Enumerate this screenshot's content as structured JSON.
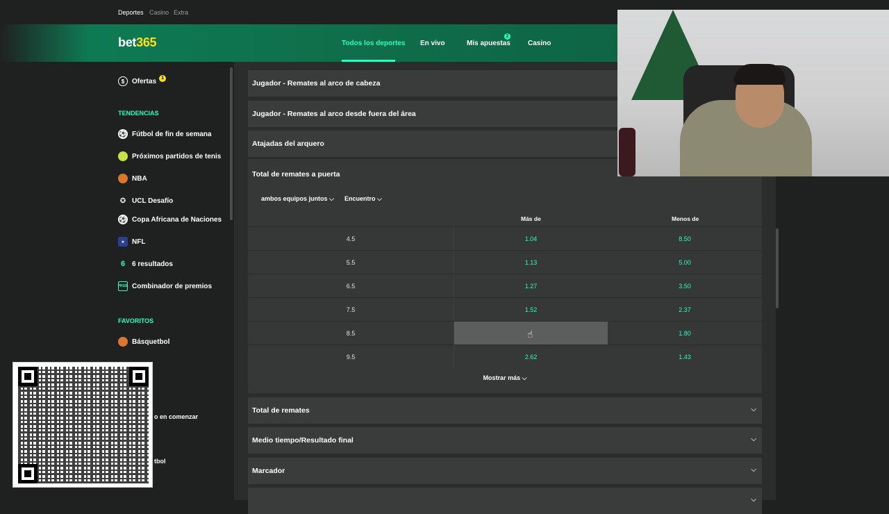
{
  "top_tabs": [
    "Deportes",
    "Casino",
    "Extra"
  ],
  "logo": {
    "main": "bet",
    "accent": "365"
  },
  "nav": {
    "items": [
      "Todos los deportes",
      "En vivo",
      "Mis apuestas",
      "Casino"
    ],
    "active": "Todos los deportes",
    "bets_badge": "2"
  },
  "sidebar": {
    "offers": {
      "label": "Ofertas",
      "badge": "1"
    },
    "trends_heading": "TENDENCIAS",
    "trends": [
      {
        "label": "Fútbol de fin de semana",
        "icon": "soccer-ball-icon"
      },
      {
        "label": "Próximos partidos de tenis",
        "icon": "tennis-ball-icon"
      },
      {
        "label": "NBA",
        "icon": "basketball-icon"
      },
      {
        "label": "UCL Desafío",
        "icon": "ucl-icon"
      },
      {
        "label": "Copa Africana de Naciones",
        "icon": "soccer-ball-icon"
      },
      {
        "label": "NFL",
        "icon": "nfl-icon"
      },
      {
        "label": "6 resultados",
        "icon": "six-results-icon"
      },
      {
        "label": "Combinador de premios",
        "icon": "prize-icon"
      }
    ],
    "favorites_heading": "FAVORITOS",
    "favorites": [
      {
        "label": "Básquetbol",
        "icon": "basketball-icon"
      }
    ],
    "partial_1": "o en comenzar",
    "partial_2": "tbol"
  },
  "markets": {
    "collapsed_top": [
      "Jugador - Remates al arco de cabeza",
      "Jugador - Remates al arco desde fuera del área",
      "Atajadas del arquero"
    ],
    "expanded": {
      "title": "Total de remates a puerta",
      "filter_team": "ambos equipos juntos",
      "filter_period": "Encuentro",
      "col_over": "Más de",
      "col_under": "Menos de",
      "rows": [
        {
          "line": "4.5",
          "over": "1.04",
          "under": "8.50"
        },
        {
          "line": "5.5",
          "over": "1.13",
          "under": "5.00"
        },
        {
          "line": "6.5",
          "over": "1.27",
          "under": "3.50"
        },
        {
          "line": "7.5",
          "over": "1.52",
          "under": "2.37"
        },
        {
          "line": "8.5",
          "over": "",
          "under": "1.80"
        },
        {
          "line": "9.5",
          "over": "2.62",
          "under": "1.43"
        }
      ],
      "show_more": "Mostrar más"
    },
    "collapsed_bottom": [
      "Total de remates",
      "Medio tiempo/Resultado final",
      "Marcador"
    ]
  }
}
